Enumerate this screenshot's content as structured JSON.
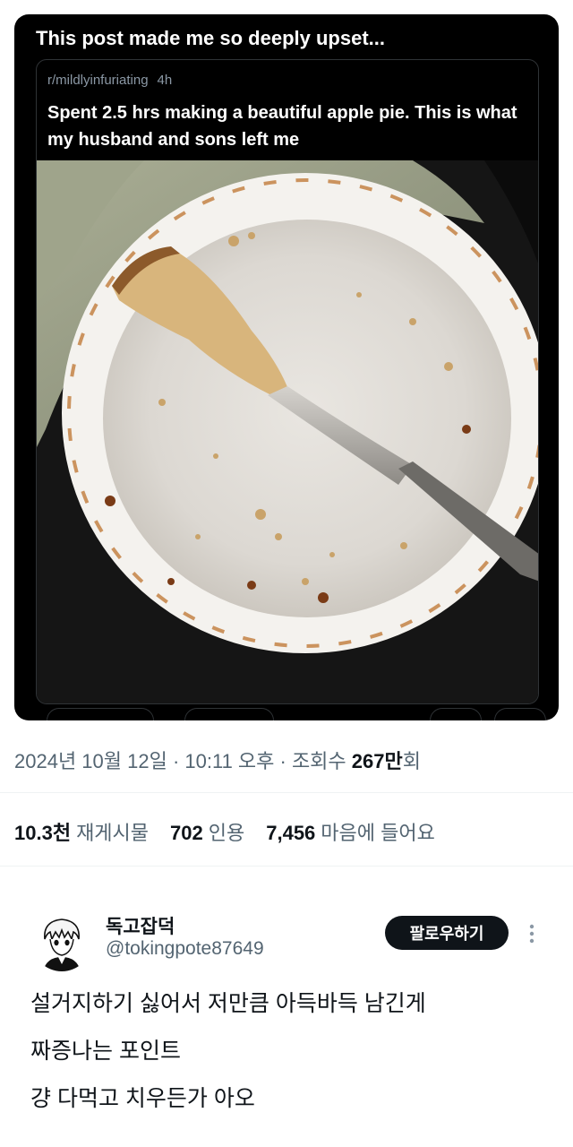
{
  "embed": {
    "headline": "This post made me so deeply upset...",
    "quoted": {
      "subreddit": "r/mildlyinfuriating",
      "age": "4h",
      "title": "Spent 2.5 hrs making a beautiful apple pie. This is what my husband and sons left me"
    }
  },
  "tweet_meta": {
    "datetime": "2024년 10월 12일 · 10:11 오후 · 조회수 ",
    "views": "267만",
    "views_suffix": "회"
  },
  "stats": {
    "reposts_count": "10.3천",
    "reposts_label": "재게시물",
    "quotes_count": "702",
    "quotes_label": "인용",
    "likes_count": "7,456",
    "likes_label": "마음에 들어요"
  },
  "reply": {
    "name": "독고잡덕",
    "handle": "@tokingpote87649",
    "follow_label": "팔로우하기",
    "more_icon": "more-vertical-icon",
    "lines": [
      "설거지하기 싫어서 저만큼 아득바득 남긴게",
      "짜증나는 포인트",
      "걍 다먹고 치우든가 아오"
    ]
  },
  "colors": {
    "text_primary": "#0f1419",
    "text_secondary": "#536471",
    "button_dark": "#0f1419",
    "embed_bg": "#000000"
  }
}
